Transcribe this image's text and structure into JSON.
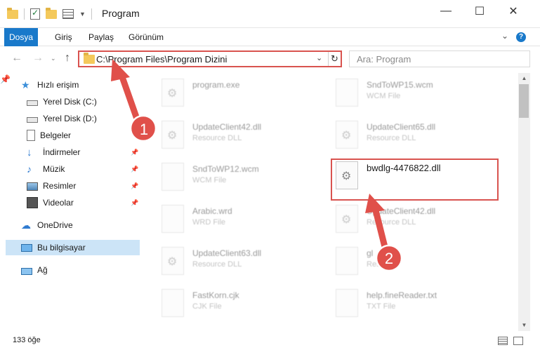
{
  "window": {
    "title": "Program",
    "controls": {
      "minimize": "—",
      "maximize": "☐",
      "close": "✕"
    }
  },
  "ribbon": {
    "tabs": [
      "Dosya",
      "Giriş",
      "Paylaş",
      "Görünüm"
    ],
    "active_tab": "Dosya",
    "accent_color": "#1979ca",
    "help": "?"
  },
  "address_bar": {
    "path": "C:\\Program Files\\Program Dizini",
    "highlight_color": "#d9534f"
  },
  "search": {
    "placeholder": "Ara: Program"
  },
  "nav_pane": {
    "items": [
      {
        "label": "Hızlı erişim",
        "icon": "star-icon"
      },
      {
        "label": "Yerel Disk (C:)",
        "icon": "drive-icon"
      },
      {
        "label": "Yerel Disk (D:)",
        "icon": "drive-icon"
      },
      {
        "label": "Belgeler",
        "icon": "document-icon"
      },
      {
        "label": "İndirmeler",
        "icon": "download-icon"
      },
      {
        "label": "Müzik",
        "icon": "music-icon"
      },
      {
        "label": "Resimler",
        "icon": "pictures-icon"
      },
      {
        "label": "Videolar",
        "icon": "video-icon"
      },
      {
        "label": "OneDrive",
        "icon": "cloud-icon"
      },
      {
        "label": "Bu bilgisayar",
        "icon": "computer-icon"
      },
      {
        "label": "Ağ",
        "icon": "network-icon"
      }
    ],
    "selected": "Bu bilgisayar"
  },
  "files": {
    "left": [
      {
        "name": "program.exe",
        "type": ""
      },
      {
        "name": "UpdateClient42.dll",
        "type": "Resource DLL"
      },
      {
        "name": "SndToWP12.wcm",
        "type": "WCM File"
      },
      {
        "name": "Arabic.wrd",
        "type": "WRD File"
      },
      {
        "name": "UpdateClient63.dll",
        "type": "Resource DLL"
      },
      {
        "name": "FastKorn.cjk",
        "type": "CJK File"
      }
    ],
    "right": [
      {
        "name": "SndToWP15.wcm",
        "type": "WCM File"
      },
      {
        "name": "UpdateClient65.dll",
        "type": "Resource DLL"
      },
      {
        "name": "bwdlg-4476822.dll",
        "type": ""
      },
      {
        "name": "UpdateClient42.dll",
        "type": "Resource DLL"
      },
      {
        "name": "gl",
        "type": "Res"
      },
      {
        "name": "help.fineReader.txt",
        "type": "TXT File"
      }
    ]
  },
  "annotations": {
    "step1": "1",
    "step2": "2",
    "color": "#e0504a"
  },
  "status": {
    "count": "133 öğe"
  }
}
